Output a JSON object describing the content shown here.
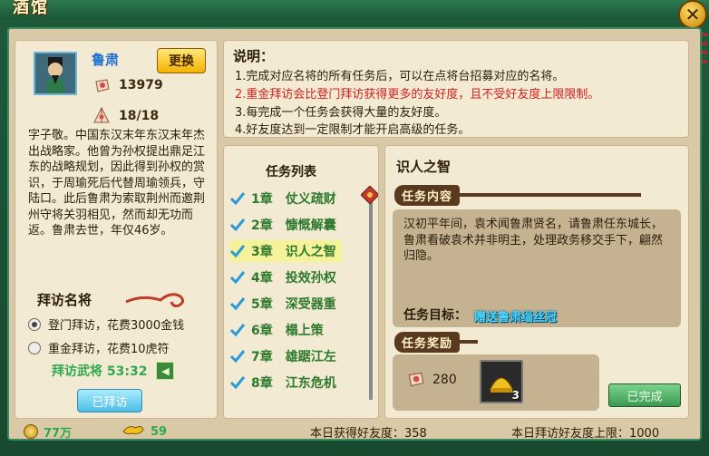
{
  "window": {
    "title": "酒馆"
  },
  "general": {
    "name": "鲁肃",
    "swap_label": "更换",
    "stat1": "13979",
    "stat2": "18/18",
    "bio": "字子敬。中国东汉末年东汉末年杰出战略家。他曾为孙权提出鼎足江东的战略规划，因此得到孙权的赏识，于周瑜死后代替周瑜领兵，守陆口。此后鲁肃为索取荆州而邀荆州守将关羽相见，然而却无功而返。鲁肃去世，年仅46岁。"
  },
  "visit": {
    "title": "拜访名将",
    "option1": "登门拜访，花费3000金钱",
    "option2": "重金拜访，花费10虎符",
    "timer": "拜访武将 53:32",
    "visited_label": "已拜访"
  },
  "notes": {
    "title": "说明：",
    "items": [
      "1.完成对应名将的所有任务后，可以在点将台招募对应的名将。",
      "2.重金拜访会比登门拜访获得更多的友好度，且不受好友度上限限制。",
      "3.每完成一个任务会获得大量的友好度。",
      "4.好友度达到一定限制才能开启高级的任务。"
    ]
  },
  "tasks": {
    "title": "任务列表",
    "items": [
      {
        "label": "1章　仗义疏财"
      },
      {
        "label": "2章　慷慨解囊"
      },
      {
        "label": "3章　识人之智"
      },
      {
        "label": "4章　投效孙权"
      },
      {
        "label": "5章　深受器重"
      },
      {
        "label": "6章　榻上策"
      },
      {
        "label": "7章　雄踞江左"
      },
      {
        "label": "8章　江东危机"
      }
    ]
  },
  "detail": {
    "title": "识人之智",
    "content_banner": "任务内容",
    "content": "汉初平年间，袁术闻鲁肃贤名，请鲁肃任东城长，鲁肃看破袁术并非明主，处理政务移交手下，翩然归隐。",
    "goal_label": "任务目标：",
    "goal_value": "赠送鲁肃缁丝冠",
    "reward_banner": "任务奖励",
    "reward_value": "280",
    "reward_item_count": "3",
    "done_label": "已完成"
  },
  "statusbar": {
    "coins": "77万",
    "tokens": "59",
    "today_friendship": "本日获得好友度：358",
    "today_limit": "本日拜访好友度上限：1000"
  },
  "colors": {
    "frame_green": "#1f5a3a",
    "panel_bg": "#f3ead3",
    "task_green": "#2d7a2d",
    "red_note": "#d42020",
    "goal_cyan": "#4fd8ff"
  },
  "icons": {
    "close": "close-icon",
    "friendship": "wine-jar-icon",
    "chapters": "fan-icon",
    "check": "check-icon"
  }
}
